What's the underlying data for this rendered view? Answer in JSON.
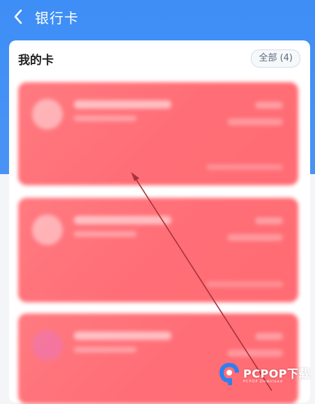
{
  "header": {
    "title": "银行卡"
  },
  "my_cards": {
    "title": "我的卡",
    "all_label": "全部 (4)"
  },
  "cards": [
    {
      "color": "#ff7078"
    },
    {
      "color": "#ff7078"
    },
    {
      "color": "#ff7078"
    }
  ],
  "watermark": {
    "brand": "PCPOP下载",
    "sub": "PCPOP Download"
  },
  "colors": {
    "header": "#3d8ef6",
    "card": "#ff7078",
    "annotation_arrow": "#b02a37"
  }
}
